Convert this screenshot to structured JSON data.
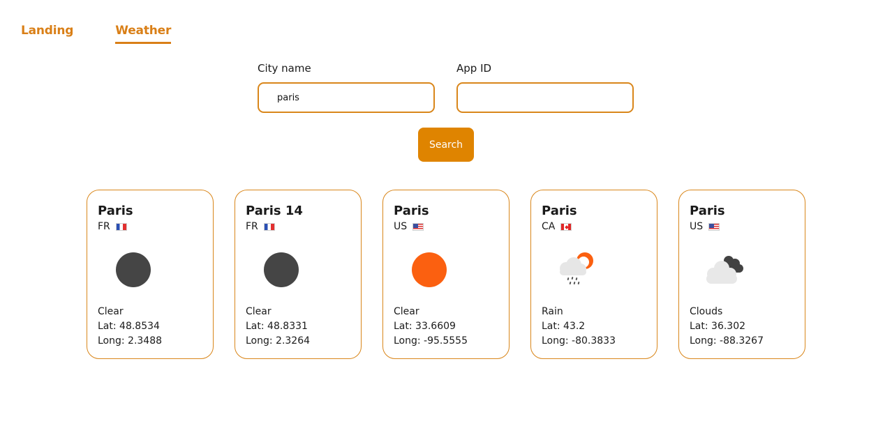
{
  "nav": {
    "links": [
      {
        "label": "Landing",
        "active": false
      },
      {
        "label": "Weather",
        "active": true
      }
    ]
  },
  "form": {
    "city_label": "City name",
    "city_value": "paris",
    "appid_label": "App ID",
    "appid_value": "",
    "search_label": "Search"
  },
  "colors": {
    "accent": "#df8400",
    "clear_night": "#454545",
    "clear_day": "#fb6010"
  },
  "cards": [
    {
      "name": "Paris",
      "country": "FR",
      "flag": "fr-flag-icon",
      "icon": "moon-icon",
      "condition": "Clear",
      "lat": "Lat: 48.8534",
      "long": "Long: 2.3488"
    },
    {
      "name": "Paris 14",
      "country": "FR",
      "flag": "fr-flag-icon",
      "icon": "moon-icon",
      "condition": "Clear",
      "lat": "Lat: 48.8331",
      "long": "Long: 2.3264"
    },
    {
      "name": "Paris",
      "country": "US",
      "flag": "us-flag-icon",
      "icon": "sun-icon",
      "condition": "Clear",
      "lat": "Lat: 33.6609",
      "long": "Long: -95.5555"
    },
    {
      "name": "Paris",
      "country": "CA",
      "flag": "ca-flag-icon",
      "icon": "rain-cloud-sun-icon",
      "condition": "Rain",
      "lat": "Lat: 43.2",
      "long": "Long: -80.3833"
    },
    {
      "name": "Paris",
      "country": "US",
      "flag": "us-flag-icon",
      "icon": "clouds-icon",
      "condition": "Clouds",
      "lat": "Lat: 36.302",
      "long": "Long: -88.3267"
    }
  ]
}
